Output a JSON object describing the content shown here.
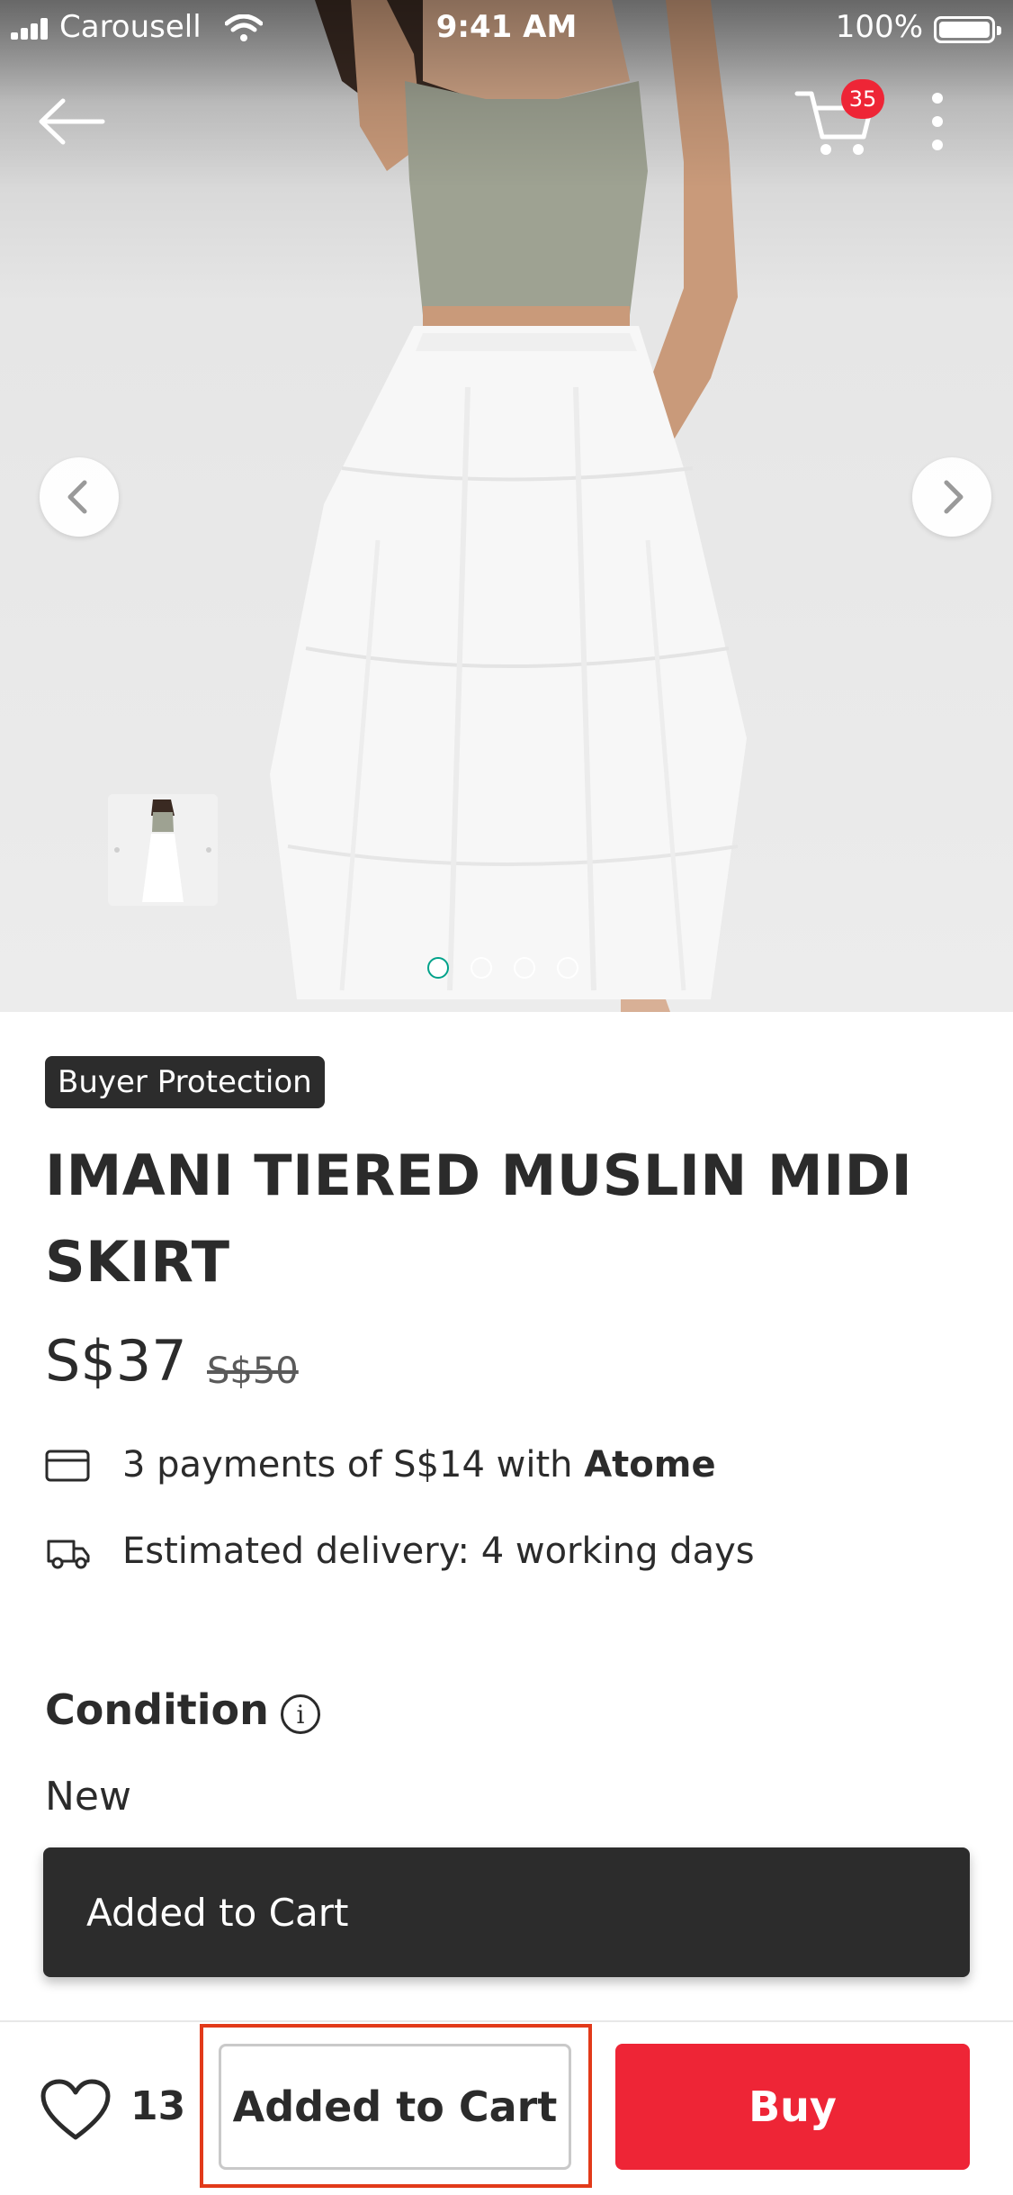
{
  "status_bar": {
    "carrier": "Carousell",
    "time": "9:41 AM",
    "battery": "100%"
  },
  "nav": {
    "cart_count": "35"
  },
  "carousel": {
    "slide_count": 4,
    "active_index": 0
  },
  "product": {
    "badge": "Buyer Protection",
    "title": "IMANI TIERED MUSLIN MIDI SKIRT",
    "price": "S$37",
    "original_price": "S$50",
    "installment": {
      "text": "3 payments of S$14 with ",
      "provider": "Atome"
    },
    "delivery": "Estimated delivery: 4 working days",
    "condition_label": "Condition",
    "condition_value": "New"
  },
  "toast": {
    "message": "Added to Cart"
  },
  "bottom_bar": {
    "like_count": "13",
    "cart_button": "Added to Cart",
    "buy_button": "Buy"
  },
  "colors": {
    "accent_red": "#ee2536",
    "dark": "#2c2c2c",
    "highlight": "#e23a1a",
    "active_dot": "#00a28a"
  }
}
